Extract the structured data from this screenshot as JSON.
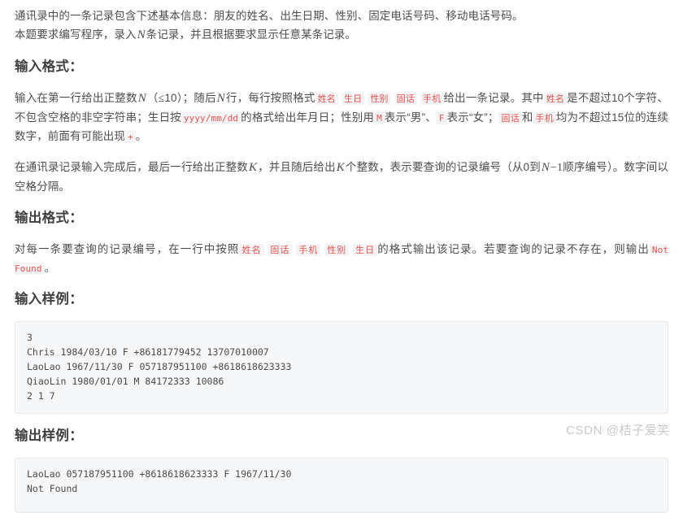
{
  "intro": {
    "line1": "通讯录中的一条记录包含下述基本信息：朋友的姓名、出生日期、性别、固定电话号码、移动电话号码。",
    "line2_a": "本题要求编写程序，录入",
    "line2_var": "N",
    "line2_b": "条记录，并且根据要求显示任意某条记录。"
  },
  "input_format": {
    "heading": "输入格式：",
    "p1_a": "输入在第一行给出正整数",
    "p1_var1": "N",
    "p1_b": "（",
    "p1_le": "≤",
    "p1_c": "10）；随后",
    "p1_var2": "N",
    "p1_d": "行，每行按照格式",
    "code_name": "姓名",
    "code_birth": "生日",
    "code_sex": "性别",
    "code_fixed": "固话",
    "code_mobile": "手机",
    "p1_e": "给出一条记录。其中",
    "p1_code_name2": "姓名",
    "p1_f": "是不超过10个字符、不包含空格的非空字符串；生日按",
    "p1_code_date": "yyyy/mm/dd",
    "p1_g": "的格式给出年月日；性别用",
    "p1_code_m": "M",
    "p1_h": "表示“男”、",
    "p1_code_f": "F",
    "p1_i": "表示“女”；",
    "p1_code_fixed2": "固话",
    "p1_j": "和",
    "p1_code_mobile2": "手机",
    "p1_k": "均为不超过15位的连续数字，前面有可能出现",
    "p1_code_plus": "+",
    "p1_l": "。",
    "p2_a": "在通讯录记录输入完成后，最后一行给出正整数",
    "p2_var1": "K",
    "p2_b": "，并且随后给出",
    "p2_var2": "K",
    "p2_c": "个整数，表示要查询的记录编号（从0到",
    "p2_var3": "N",
    "p2_minus": "−",
    "p2_one": "1",
    "p2_d": "顺序编号）。数字间以空格分隔。"
  },
  "output_format": {
    "heading": "输出格式：",
    "p1_a": "对每一条要查询的记录编号，在一行中按照",
    "code_name": "姓名",
    "code_fixed": "固话",
    "code_mobile": "手机",
    "code_sex": "性别",
    "code_birth": "生日",
    "p1_b": "的格式输出该记录。若要查询的记录不存在，则输出",
    "code_notfound": "Not Found",
    "p1_c": "。"
  },
  "input_sample": {
    "heading": "输入样例：",
    "code": "3\nChris 1984/03/10 F +86181779452 13707010007\nLaoLao 1967/11/30 F 057187951100 +8618618623333\nQiaoLin 1980/01/01 M 84172333 10086\n2 1 7"
  },
  "output_sample": {
    "heading": "输出样例：",
    "code": "LaoLao 057187951100 +8618618623333 F 1967/11/30\nNot Found"
  },
  "watermark": {
    "text": "CSDN @桔子爱笑"
  },
  "colors": {
    "inline_code_text": "#e8554d",
    "inline_code_bg": "#f4f3f5",
    "codeblock_bg": "#f6f7f9",
    "codeblock_border": "#e6e8eb",
    "body_text": "#4d4d4d",
    "heading_text": "#3f3f3f",
    "watermark_text": "#c9c9c9"
  }
}
